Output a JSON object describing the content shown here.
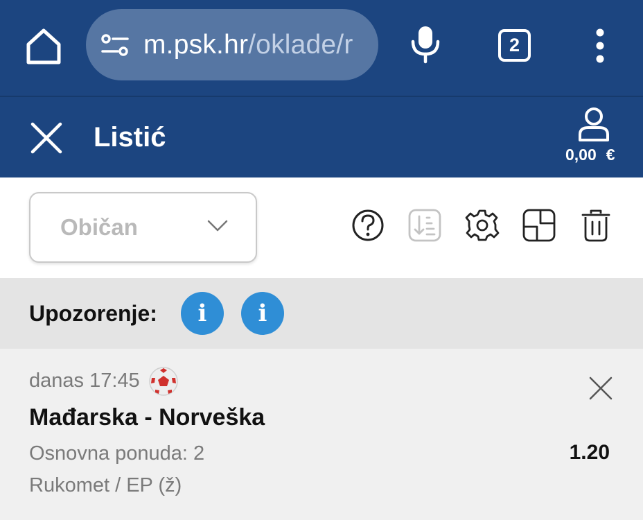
{
  "browser": {
    "url_host": "m.psk.hr",
    "url_path": "/oklade/r",
    "tab_count": "2",
    "icons": [
      "home-icon",
      "site-settings-icon",
      "mic-icon",
      "tabs-icon",
      "more-vert-icon"
    ]
  },
  "header": {
    "title": "Listić",
    "balance_amount": "0,00",
    "balance_currency": "€",
    "icons": [
      "close-icon",
      "account-icon"
    ]
  },
  "toolbar": {
    "ticket_type": "Običan",
    "icons": [
      "help-icon",
      "sort-icon",
      "settings-icon",
      "split-icon",
      "trash-icon"
    ]
  },
  "warning": {
    "label": "Upozorenje:",
    "badge_1": "i",
    "badge_2": "i"
  },
  "bet": {
    "time": "danas 17:45",
    "match": "Mađarska - Norveška",
    "offer": "Osnovna ponuda: 2",
    "odds": "1.20",
    "league": "Rukomet / EP (ž)",
    "sport_icon": "handball-icon"
  },
  "colors": {
    "header_bg": "#1c4580",
    "url_pill_bg": "#5676a3",
    "info_badge": "#2f8ed6",
    "warning_bg": "#e4e4e4",
    "card_bg": "#f0f0f0"
  }
}
